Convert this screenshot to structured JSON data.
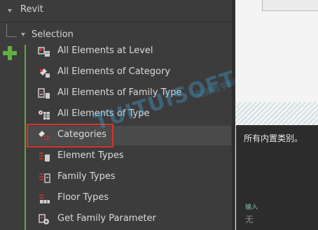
{
  "library": {
    "header_label": "Revit",
    "group_label": "Selection",
    "items": [
      {
        "label": "All Elements at Level",
        "icon": "level-elements-icon"
      },
      {
        "label": "All Elements of Category",
        "icon": "category-elements-icon"
      },
      {
        "label": "All Elements of Family Type",
        "icon": "family-type-elements-icon"
      },
      {
        "label": "All Elements of Type",
        "icon": "type-elements-icon"
      },
      {
        "label": "Categories",
        "icon": "categories-icon"
      },
      {
        "label": "Element Types",
        "icon": "element-types-icon"
      },
      {
        "label": "Family Types",
        "icon": "family-types-icon"
      },
      {
        "label": "Floor Types",
        "icon": "floor-types-icon"
      },
      {
        "label": "Get Family Parameter",
        "icon": "get-family-parameter-icon"
      }
    ],
    "selected_index": 4
  },
  "tooltip": {
    "description": "所有内置类别。",
    "input_label": "输入",
    "input_value": "无"
  },
  "watermark": {
    "text": "TUITUISOFT",
    "subtext": "腿腿教学网"
  },
  "colors": {
    "accent_green": "#62b042",
    "highlight_red": "#d9342b",
    "panel_bg": "#3c3c3c",
    "tooltip_bg": "#2c2c2c"
  }
}
